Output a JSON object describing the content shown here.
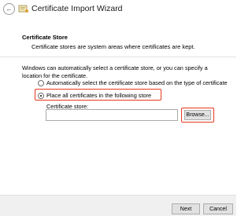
{
  "window": {
    "title": "Certificate Import Wizard",
    "back_icon": "arrow-left-icon",
    "app_icon": "certificate-wizard-icon"
  },
  "header": {
    "section_title": "Certificate Store",
    "section_description": "Certificate stores are system areas where certificates are kept."
  },
  "content": {
    "intro_text": "Windows can automatically select a certificate store, or you can specify a location for the certificate.",
    "options": [
      {
        "label": "Automatically select the certificate store based on the type of certificate",
        "selected": false
      },
      {
        "label": "Place all certificates in the following store",
        "selected": true
      }
    ],
    "store_label": "Certificate store:",
    "store_value": "",
    "browse_label": "Browse..."
  },
  "footer": {
    "next_label": "Next",
    "cancel_label": "Cancel"
  },
  "colors": {
    "highlight": "#e5391e",
    "footer_bg": "#f0f0f0",
    "button_bg": "#e1e1e1"
  }
}
